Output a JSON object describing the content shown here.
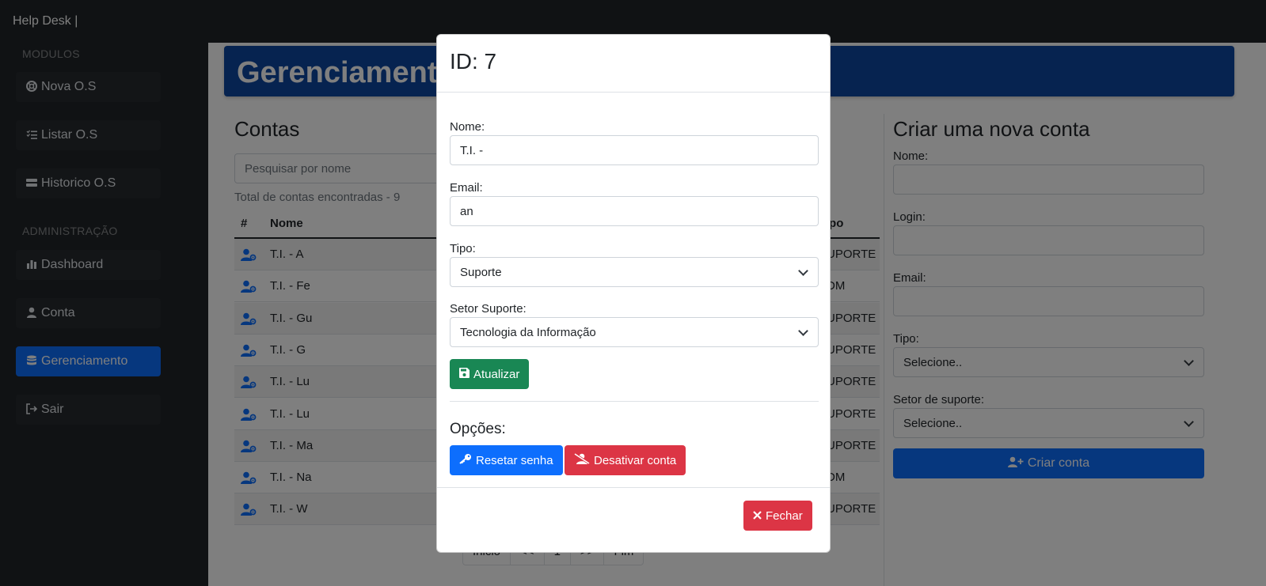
{
  "app": {
    "brand": "Help Desk |"
  },
  "sidebar": {
    "section_modulos": "MODULOS",
    "section_admin": "ADMINISTRAÇÃO",
    "items": [
      {
        "label": "Nova O.S",
        "icon": "life-ring-icon"
      },
      {
        "label": "Listar O.S",
        "icon": "list-check-icon"
      },
      {
        "label": "Historico O.S",
        "icon": "server-icon"
      },
      {
        "label": "Dashboard",
        "icon": "bar-chart-icon"
      },
      {
        "label": "Conta",
        "icon": "user-icon"
      },
      {
        "label": "Gerenciamento",
        "icon": "database-icon",
        "active": true
      },
      {
        "label": "Sair",
        "icon": "sign-out-icon"
      }
    ]
  },
  "main": {
    "banner_title": "Gerenciamento",
    "contas": {
      "title": "Contas",
      "search_placeholder": "Pesquisar por nome",
      "total_text": "Total de contas encontradas - 9",
      "headers": {
        "hash": "#",
        "nome": "Nome",
        "tipo": "Tipo"
      },
      "rows": [
        {
          "nome": "T.I. - A",
          "tipo": "SUPORTE"
        },
        {
          "nome": "T.I. - Fe",
          "tipo": "ADM"
        },
        {
          "nome": "T.I. - Gu",
          "tipo": "SUPORTE"
        },
        {
          "nome": "T.I. - G",
          "tipo": "SUPORTE"
        },
        {
          "nome": "T.I. - Lu",
          "tipo": "SUPORTE"
        },
        {
          "nome": "T.I. - Lu",
          "tipo": "SUPORTE"
        },
        {
          "nome": "T.I. - Ma",
          "tipo": "SUPORTE"
        },
        {
          "nome": "T.I. - Na",
          "tipo": "ADM"
        },
        {
          "nome": "T.I. - W",
          "tipo": "SUPORTE"
        }
      ],
      "pagination": [
        "Inicio",
        "<<",
        "1",
        ">>",
        "Fim"
      ]
    },
    "criar": {
      "title": "Criar uma nova conta",
      "nome_label": "Nome:",
      "login_label": "Login:",
      "email_label": "Email:",
      "tipo_label": "Tipo:",
      "tipo_value": "Selecione..",
      "setor_label": "Setor de suporte:",
      "setor_value": "Selecione..",
      "button": "Criar conta"
    }
  },
  "modal": {
    "title": "ID: 7",
    "nome_label": "Nome:",
    "nome_value": "T.I. -",
    "email_label": "Email:",
    "email_value": "an",
    "tipo_label": "Tipo:",
    "tipo_value": "Suporte",
    "setor_label": "Setor Suporte:",
    "setor_value": "Tecnologia da Informação",
    "atualizar": "Atualizar",
    "opcoes": "Opções:",
    "resetar": "Resetar senha",
    "desativar": "Desativar conta",
    "fechar": "Fechar"
  },
  "colors": {
    "primary": "#0d6efd",
    "success": "#198754",
    "danger": "#dc3545",
    "dark": "#212529",
    "banner": "#0d47a1"
  }
}
